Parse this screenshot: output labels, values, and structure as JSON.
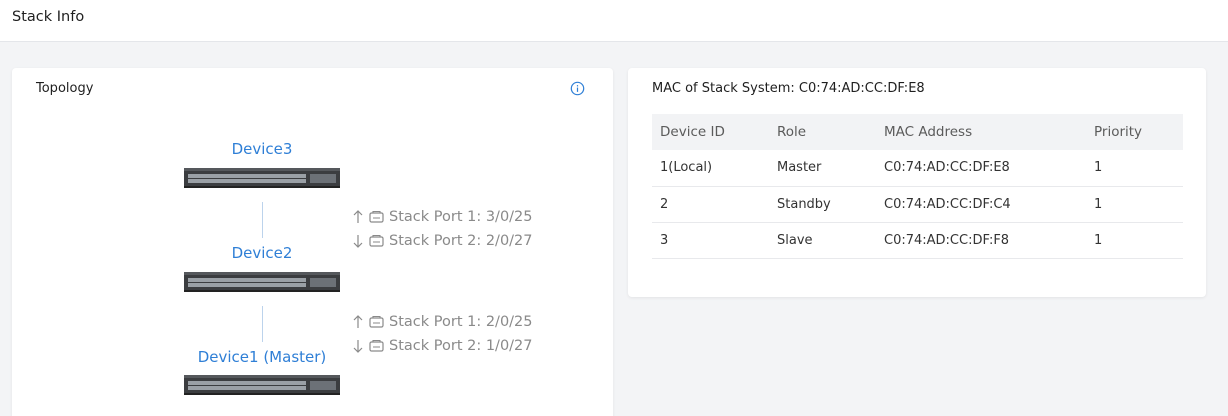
{
  "page": {
    "title": "Stack Info"
  },
  "topology": {
    "title": "Topology",
    "devices": [
      {
        "label": "Device3"
      },
      {
        "label": "Device2"
      },
      {
        "label": "Device1 (Master)"
      }
    ],
    "links": [
      {
        "port1": "Stack Port 1: 3/0/25",
        "port2": "Stack Port 2: 2/0/27"
      },
      {
        "port1": "Stack Port 1: 2/0/25",
        "port2": "Stack Port 2: 1/0/27"
      }
    ]
  },
  "mac_panel": {
    "title": "MAC of Stack System: C0:74:AD:CC:DF:E8",
    "columns": [
      "Device ID",
      "Role",
      "MAC Address",
      "Priority"
    ],
    "rows": [
      [
        "1(Local)",
        "Master",
        "C0:74:AD:CC:DF:E8",
        "1"
      ],
      [
        "2",
        "Standby",
        "C0:74:AD:CC:DF:C4",
        "1"
      ],
      [
        "3",
        "Slave",
        "C0:74:AD:CC:DF:F8",
        "1"
      ]
    ]
  },
  "colors": {
    "accent": "#2f7fd6",
    "muted": "#8a8a8a"
  },
  "icons": [
    "info-icon",
    "switch-device-icon",
    "arrow-up-icon",
    "arrow-down-icon",
    "stack-port-icon"
  ]
}
